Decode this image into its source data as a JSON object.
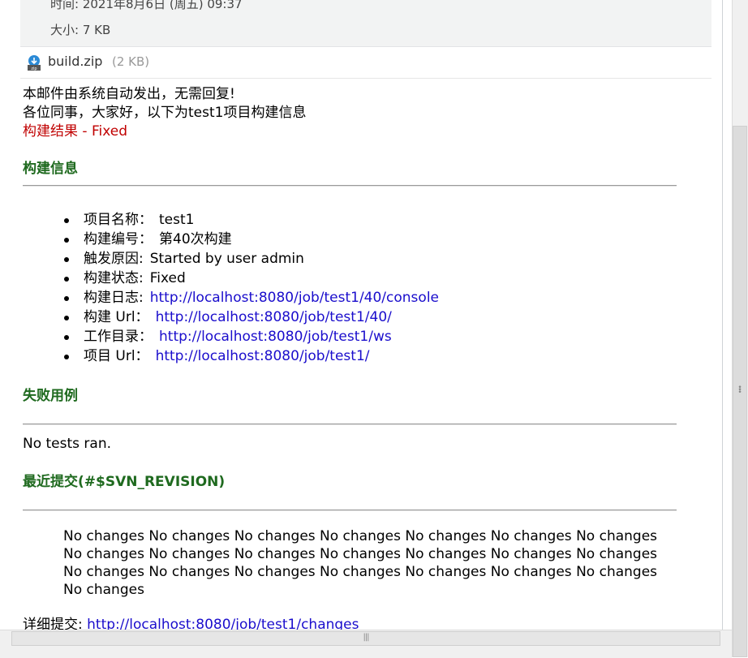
{
  "header": {
    "time_line": "时间: 2021年8月6日 (周五) 09:37",
    "size_line": "大小: 7 KB"
  },
  "attachment": {
    "icon": "zip-file-icon",
    "name": "build.zip",
    "size": "(2 KB)"
  },
  "email": {
    "intro": "本邮件由系统自动发出，无需回复!",
    "greeting": "各位同事，大家好，以下为test1项目构建信息",
    "result": "构建结果 - Fixed",
    "build_info_title": "构建信息",
    "items": [
      {
        "label": "项目名称：",
        "value": "test1",
        "is_link": false
      },
      {
        "label": "构建编号：",
        "value": "第40次构建",
        "is_link": false
      },
      {
        "label": "触发原因:",
        "value": "Started by user admin",
        "is_link": false
      },
      {
        "label": "构建状态:",
        "value": "Fixed",
        "is_link": false
      },
      {
        "label": "构建日志:",
        "value": "http://localhost:8080/job/test1/40/console",
        "is_link": true
      },
      {
        "label": "构建 Url：",
        "value": "http://localhost:8080/job/test1/40/",
        "is_link": true
      },
      {
        "label": "工作目录：",
        "value": "http://localhost:8080/job/test1/ws",
        "is_link": true
      },
      {
        "label": "项目 Url：",
        "value": "http://localhost:8080/job/test1/",
        "is_link": true
      }
    ],
    "failed_title": "失败用例",
    "failed_text": "No tests ran.",
    "recent_title": "最近提交(#$SVN_REVISION)",
    "changes_text": "No changes No changes No changes No changes No changes No changes No changes No changes No changes No changes No changes No changes No changes No changes No changes No changes No changes No changes No changes No changes No changes No changes",
    "details_label": "详细提交:",
    "details_link": "http://localhost:8080/job/test1/changes"
  },
  "colors": {
    "section_title": "#1f6a1f",
    "result_red": "#c00000",
    "link": "#1a0dcc"
  }
}
